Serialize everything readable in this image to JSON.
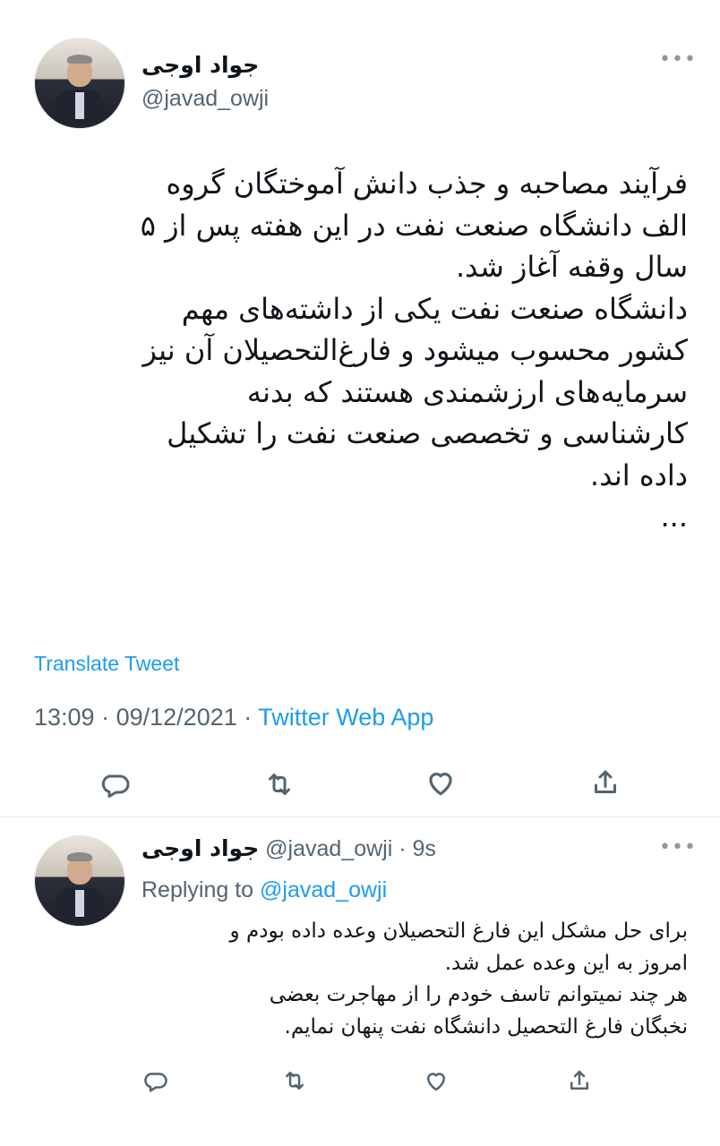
{
  "main_tweet": {
    "display_name": "جواد اوجی",
    "handle": "@javad_owji",
    "more_icon": "more-dots-icon",
    "body": "فرآیند مصاحبه و جذب دانش آموختگان گروه\nالف دانشگاه صنعت نفت در این هفته پس از ۵\nسال وقفه آغاز شد.\nدانشگاه صنعت نفت یکی از داشته‌های مهم\nکشور محسوب میشود و فارغ‌التحصیلان آن نیز\nسرمایه‌های ارزشمندی هستند که بدنه\nکارشناسی و تخصصی صنعت نفت را تشکیل\nداده اند.\n...",
    "translate_label": "Translate Tweet",
    "time": "13:09",
    "date": "09/12/2021",
    "separator": "·",
    "source": "Twitter Web App",
    "actions": [
      "reply-icon",
      "retweet-icon",
      "like-icon",
      "share-icon"
    ]
  },
  "reply_tweet": {
    "display_name": "جواد اوجی",
    "handle": "@javad_owji",
    "separator": "·",
    "age": "9s",
    "replying_prefix": "Replying to",
    "replying_handle": "@javad_owji",
    "body": "برای حل مشکل این فارغ التحصیلان وعده داده بودم و\nامروز به این وعده عمل شد.\nهر چند نمیتوانم تاسف خودم را از مهاجرت بعضی\nنخبگان فارغ التحصیل دانشگاه نفت پنهان نمایم.",
    "actions": [
      "reply-icon",
      "retweet-icon",
      "like-icon",
      "share-icon"
    ]
  },
  "colors": {
    "accent": "#1d9bf0",
    "secondary_text": "#536471",
    "primary_text": "#0f1419",
    "divider": "#e1e8ed"
  }
}
